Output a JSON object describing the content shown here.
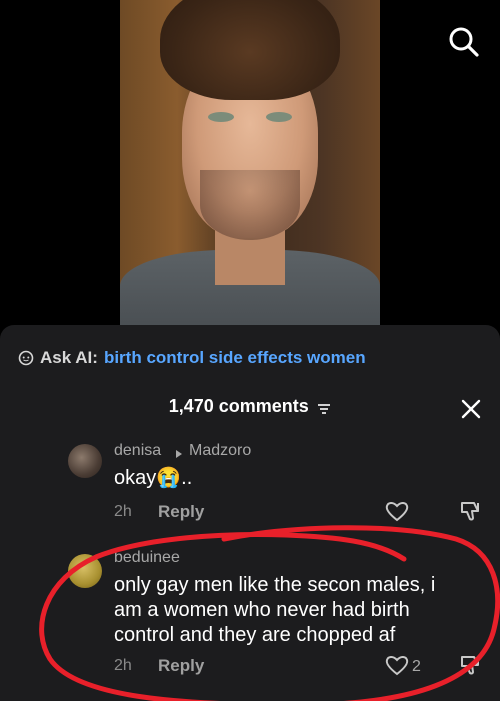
{
  "ask_ai": {
    "label": "Ask AI:",
    "query": "birth control side effects women"
  },
  "comments_header": {
    "count_label": "1,470 comments"
  },
  "comments": [
    {
      "username": "denisa",
      "reply_to": "Madzoro",
      "text": "okay😭..",
      "time": "2h",
      "reply_label": "Reply"
    },
    {
      "username": "beduinee",
      "text_lines": [
        "only gay men like the secon males, i",
        "am a women who never had birth",
        "control and they are chopped af"
      ],
      "time": "2h",
      "reply_label": "Reply",
      "likes": "2"
    }
  ],
  "colors": {
    "sheet_bg": "#1c1c1e",
    "link_blue": "#58a6ff",
    "annotation_red": "#e8202a"
  },
  "icons": {
    "search": "search-icon",
    "ask_ai": "ai-chat-icon",
    "filter": "filter-icon",
    "close": "close-icon",
    "like": "heart-icon",
    "dislike": "thumbs-down-icon"
  }
}
